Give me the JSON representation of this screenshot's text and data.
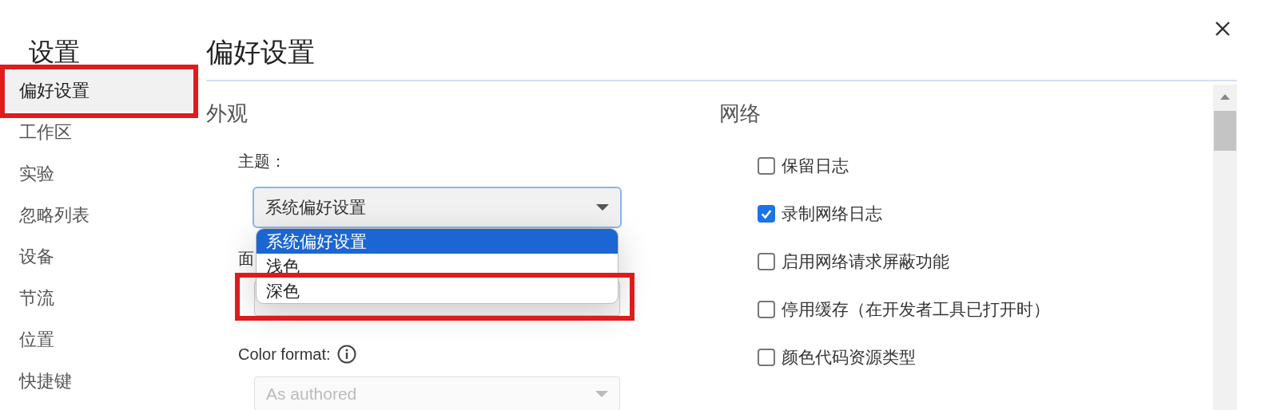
{
  "sidebar": {
    "title": "设置",
    "items": [
      {
        "label": "偏好设置",
        "selected": true,
        "highlighted": true
      },
      {
        "label": "工作区",
        "selected": false,
        "highlighted": false
      },
      {
        "label": "实验",
        "selected": false,
        "highlighted": false
      },
      {
        "label": "忽略列表",
        "selected": false,
        "highlighted": false
      },
      {
        "label": "设备",
        "selected": false,
        "highlighted": false
      },
      {
        "label": "节流",
        "selected": false,
        "highlighted": false
      },
      {
        "label": "位置",
        "selected": false,
        "highlighted": false
      },
      {
        "label": "快捷键",
        "selected": false,
        "highlighted": false
      }
    ]
  },
  "page": {
    "title": "偏好设置"
  },
  "appearance": {
    "title": "外观",
    "fields": [
      {
        "label": "主题：",
        "info": false,
        "focused": true,
        "disabled": false,
        "value": "系统偏好设置",
        "dropdown": {
          "options": [
            {
              "label": "系统偏好设置",
              "selected": true,
              "highlighted": false
            },
            {
              "label": "浅色",
              "selected": false,
              "highlighted": false
            },
            {
              "label": "深色",
              "selected": false,
              "highlighted": true
            }
          ]
        }
      },
      {
        "label": "面",
        "info": false,
        "focused": false,
        "disabled": false
      },
      {
        "label": "Color format:",
        "info": true,
        "focused": false,
        "disabled": true,
        "value": "As authored"
      }
    ]
  },
  "network": {
    "title": "网络",
    "options": [
      {
        "label": "保留日志",
        "checked": false
      },
      {
        "label": "录制网络日志",
        "checked": true
      },
      {
        "label": "启用网络请求屏蔽功能",
        "checked": false
      },
      {
        "label": "停用缓存（在开发者工具已打开时）",
        "checked": false
      },
      {
        "label": "颜色代码资源类型",
        "checked": false
      }
    ]
  }
}
